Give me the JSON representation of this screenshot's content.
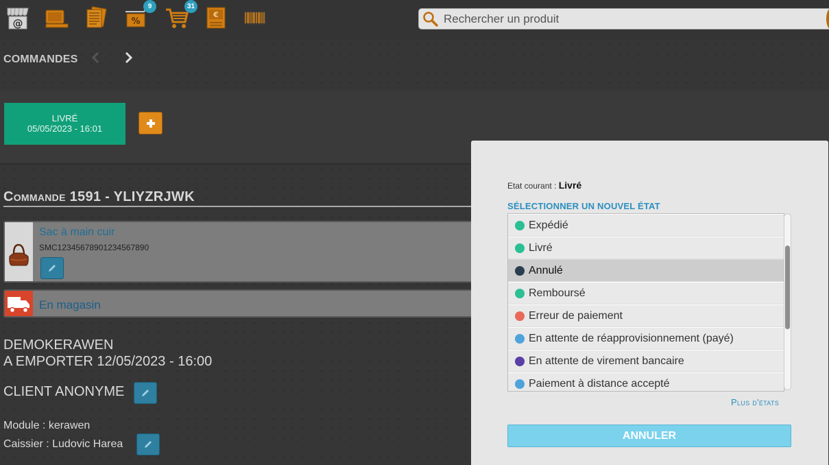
{
  "topbar": {
    "icons": [
      {
        "name": "shop-online-icon"
      },
      {
        "name": "pos-terminal-icon"
      },
      {
        "name": "catalog-icon"
      },
      {
        "name": "discount-icon",
        "badge": "9"
      },
      {
        "name": "cart-icon",
        "badge": "31"
      },
      {
        "name": "cash-register-icon"
      },
      {
        "name": "barcode-icon"
      }
    ],
    "search_placeholder": "Rechercher un produit"
  },
  "commandes": {
    "title": "COMMANDES"
  },
  "state_tile": {
    "label": "LIVRÉ",
    "date": "05/05/2023 - 16:01"
  },
  "order": {
    "title_prefix": "Commande",
    "title_rest": "1591 - YLIYZRJWK",
    "product": {
      "name": "Sac à main cuir",
      "ref": "SMC12345678901234567890"
    },
    "delivery": {
      "label": "En magasin"
    },
    "customer_line1": "DEMOKERAWEN",
    "customer_line2": "A EMPORTER 12/05/2023 - 16:00",
    "client": "CLIENT ANONYME",
    "module": "Module : kerawen",
    "cashier": "Caissier : Ludovic Harea"
  },
  "modal": {
    "current_label": "Etat courant :",
    "current_value": "Livré",
    "select_title": "SÉLECTIONNER UN NOUVEL ÉTAT",
    "states": [
      {
        "label": "Expédié",
        "color": "#2bbf94",
        "selected": false
      },
      {
        "label": "Livré",
        "color": "#2bbf94",
        "selected": false
      },
      {
        "label": "Annulé",
        "color": "#2b3d50",
        "selected": true
      },
      {
        "label": "Remboursé",
        "color": "#2bbf94",
        "selected": false
      },
      {
        "label": "Erreur de paiement",
        "color": "#e8695c",
        "selected": false
      },
      {
        "label": "En attente de réapprovisionnement (payé)",
        "color": "#4fa3dc",
        "selected": false
      },
      {
        "label": "En attente de virement bancaire",
        "color": "#5a3fa6",
        "selected": false
      },
      {
        "label": "Paiement à distance accepté",
        "color": "#4fa3dc",
        "selected": false
      },
      {
        "label": "",
        "color": "#4fa3dc",
        "selected": false
      }
    ],
    "more_states": "Plus d'états",
    "cancel": "ANNULER"
  }
}
